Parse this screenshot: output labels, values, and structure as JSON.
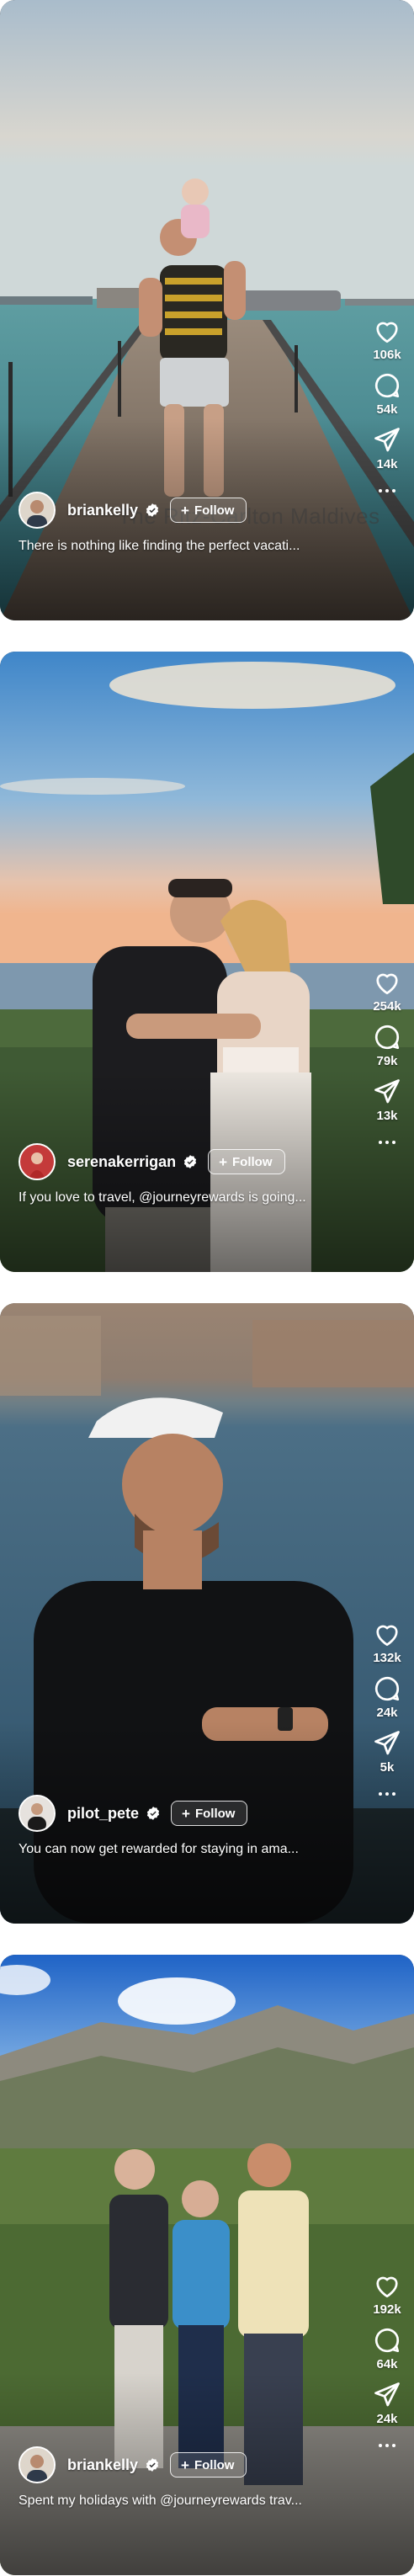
{
  "feed": {
    "posts": [
      {
        "username": "briankelly",
        "verified": true,
        "follow_label": "Follow",
        "caption": "There is nothing like finding the perfect vacati...",
        "location_overlay": "The Ritz-Carlton Maldives",
        "likes": "106k",
        "comments": "54k",
        "shares": "14k"
      },
      {
        "username": "serenakerrigan",
        "verified": true,
        "follow_label": "Follow",
        "caption": "If you love to travel, @journeyrewards is going...",
        "likes": "254k",
        "comments": "79k",
        "shares": "13k"
      },
      {
        "username": "pilot_pete",
        "verified": true,
        "follow_label": "Follow",
        "caption": "You can now get rewarded for staying in ama...",
        "likes": "132k",
        "comments": "24k",
        "shares": "5k"
      },
      {
        "username": "briankelly",
        "verified": true,
        "follow_label": "Follow",
        "caption": "Spent my holidays with @journeyrewards trav...",
        "likes": "192k",
        "comments": "64k",
        "shares": "24k"
      }
    ]
  },
  "icons": {
    "like": "heart-icon",
    "comment": "speech-bubble-icon",
    "share": "paper-plane-icon",
    "more": "more-horizontal-icon",
    "verified": "verified-badge-icon",
    "follow": "plus-icon"
  },
  "colors": {
    "verified_badge": "#ffffff",
    "text": "#ffffff"
  }
}
